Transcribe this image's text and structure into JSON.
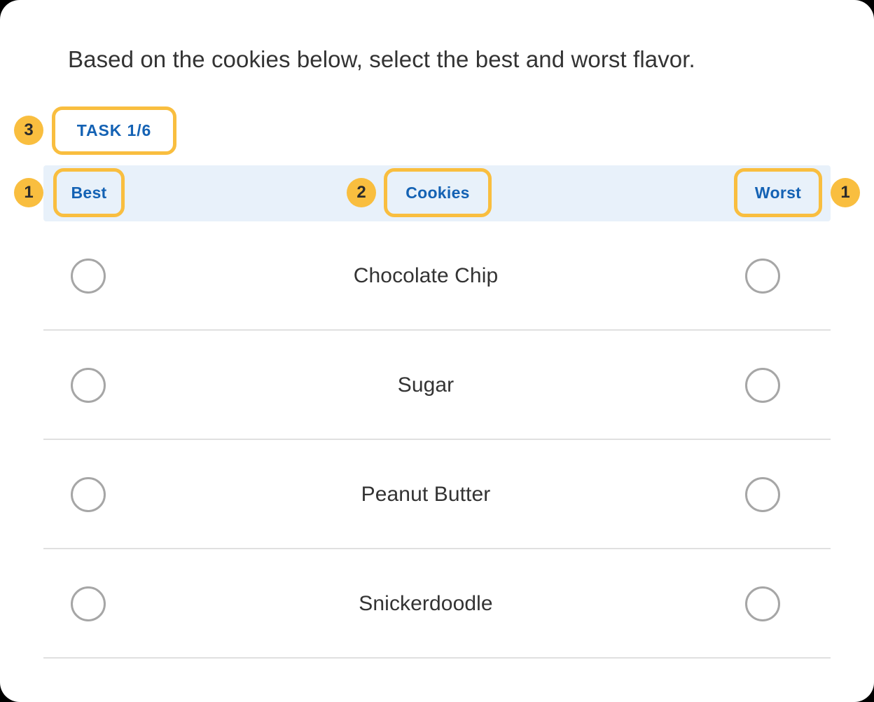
{
  "question": {
    "title": "Based on the cookies below, select the best and worst flavor."
  },
  "task": {
    "label": "TASK 1/6"
  },
  "table": {
    "header": {
      "best": "Best",
      "middle": "Cookies",
      "worst": "Worst"
    },
    "rows": [
      {
        "label": "Chocolate Chip"
      },
      {
        "label": "Sugar"
      },
      {
        "label": "Peanut Butter"
      },
      {
        "label": "Snickerdoodle"
      }
    ]
  },
  "annotations": [
    {
      "id": "annot-1a",
      "number": "1"
    },
    {
      "id": "annot-1b",
      "number": "1"
    },
    {
      "id": "annot-2",
      "number": "2"
    },
    {
      "id": "annot-3",
      "number": "3"
    }
  ],
  "colors": {
    "annotation": "#F9BE3F",
    "header_text": "#1462B4",
    "header_bar_bg": "#E8F1FA",
    "body_text": "#333333",
    "radio_border": "#A6A6A6",
    "divider": "#E0E0E0",
    "card_bg": "#FFFFFF",
    "page_bg": "#000000"
  }
}
